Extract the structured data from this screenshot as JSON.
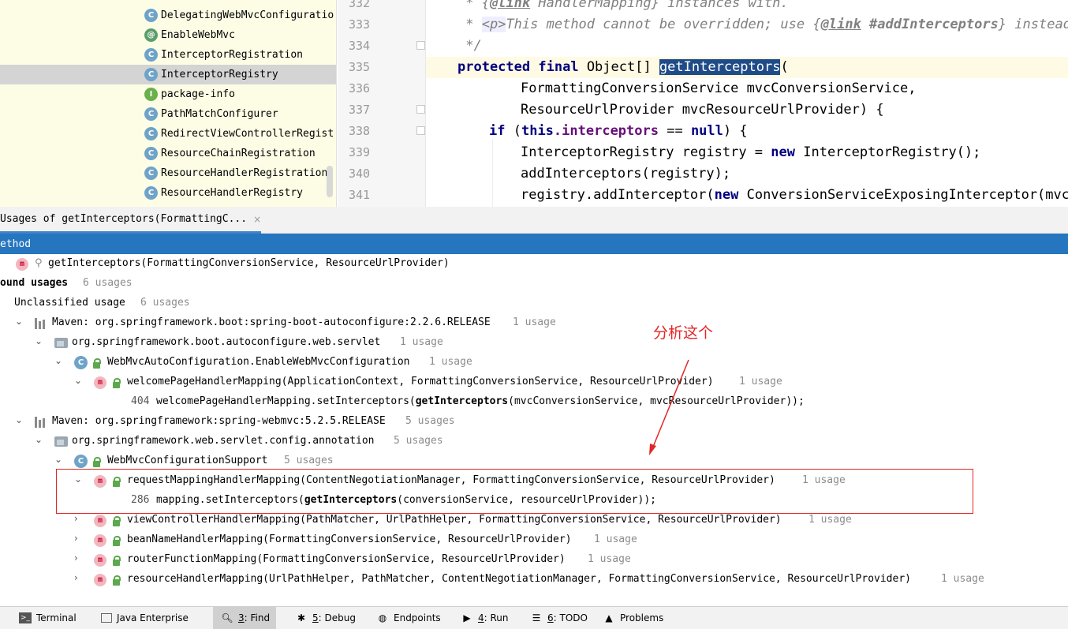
{
  "project_tree": {
    "items": [
      {
        "icon": "class-icon",
        "badge": "C",
        "label": "DelegatingWebMvcConfiguratio",
        "selected": false
      },
      {
        "icon": "annotation-icon",
        "badge": "@",
        "label": "EnableWebMvc",
        "selected": false
      },
      {
        "icon": "class-icon",
        "badge": "C",
        "label": "InterceptorRegistration",
        "selected": false
      },
      {
        "icon": "class-icon",
        "badge": "C",
        "label": "InterceptorRegistry",
        "selected": true
      },
      {
        "icon": "package-info-icon",
        "badge": "I",
        "label": "package-info",
        "selected": false
      },
      {
        "icon": "class-icon",
        "badge": "C",
        "label": "PathMatchConfigurer",
        "selected": false
      },
      {
        "icon": "class-icon",
        "badge": "C",
        "label": "RedirectViewControllerRegist",
        "selected": false
      },
      {
        "icon": "class-icon",
        "badge": "C",
        "label": "ResourceChainRegistration",
        "selected": false
      },
      {
        "icon": "class-icon",
        "badge": "C",
        "label": "ResourceHandlerRegistration",
        "selected": false
      },
      {
        "icon": "class-icon",
        "badge": "C",
        "label": "ResourceHandlerRegistry",
        "selected": false
      }
    ]
  },
  "editor": {
    "line_numbers": [
      "332",
      "333",
      "334",
      "335",
      "336",
      "337",
      "338",
      "339",
      "340",
      "341"
    ],
    "current_line": "335",
    "code": {
      "l332_prefix": " * {",
      "l332_link": "@link",
      "l332_rest": " HandlerMapping} instances with.",
      "l333_prefix": " * ",
      "l333_p": "<p>",
      "l333_mid": "This method cannot be overridden; use {",
      "l333_link": "@link",
      "l333_ref": " #addInterceptors",
      "l333_end": "} instead.",
      "l334": " */",
      "l335_kw1": "protected",
      "l335_kw2": "final",
      "l335_type": "Object[] ",
      "l335_method": "getInterceptors",
      "l335_paren": "(",
      "l336": "FormattingConversionService mvcConversionService,",
      "l337": "ResourceUrlProvider mvcResourceUrlProvider) {",
      "l338_kw": "if",
      "l338_a": " (",
      "l338_this": "this",
      "l338_field": ".interceptors",
      "l338_eq": " == ",
      "l338_null": "null",
      "l338_end": ") {",
      "l339_a": "InterceptorRegistry registry = ",
      "l339_new": "new",
      "l339_b": " InterceptorRegistry();",
      "l340": "addInterceptors(registry);",
      "l341_a": "registry.addInterceptor(",
      "l341_new": "new",
      "l341_b": " ConversionServiceExposingInterceptor(mvcCo"
    }
  },
  "find": {
    "tab_label": "Usages of getInterceptors(FormattingC...",
    "close_glyph": "×",
    "method_header": "ethod",
    "method_signature": "getInterceptors(FormattingConversionService, ResourceUrlProvider)",
    "found_label": "ound usages",
    "found_count": "6 usages",
    "unclassified_label": "Unclassified usage",
    "unclassified_count": "6 usages",
    "groups": {
      "boot_lib": "Maven: org.springframework.boot:spring-boot-autoconfigure:2.2.6.RELEASE",
      "boot_lib_count": "1 usage",
      "boot_pkg": "org.springframework.boot.autoconfigure.web.servlet",
      "boot_pkg_count": "1 usage",
      "boot_class": "WebMvcAutoConfiguration.EnableWebMvcConfiguration",
      "boot_class_count": "1 usage",
      "boot_method": "welcomePageHandlerMapping(ApplicationContext, FormattingConversionService, ResourceUrlProvider)",
      "boot_method_count": "1 usage",
      "boot_line_no": "404",
      "boot_line_a": "welcomePageHandlerMapping.setInterceptors(",
      "boot_line_b": "getInterceptors",
      "boot_line_c": "(mvcConversionService, mvcResourceUrlProvider));",
      "webmvc_lib": "Maven: org.springframework:spring-webmvc:5.2.5.RELEASE",
      "webmvc_lib_count": "5 usages",
      "webmvc_pkg": "org.springframework.web.servlet.config.annotation",
      "webmvc_pkg_count": "5 usages",
      "webmvc_class": "WebMvcConfigurationSupport",
      "webmvc_class_count": "5 usages",
      "m1": "requestMappingHandlerMapping(ContentNegotiationManager, FormattingConversionService, ResourceUrlProvider)",
      "m1_count": "1 usage",
      "m1_line_no": "286",
      "m1_line_a": "mapping.setInterceptors(",
      "m1_line_b": "getInterceptors",
      "m1_line_c": "(conversionService, resourceUrlProvider));",
      "m2": "viewControllerHandlerMapping(PathMatcher, UrlPathHelper, FormattingConversionService, ResourceUrlProvider)",
      "m2_count": "1 usage",
      "m3": "beanNameHandlerMapping(FormattingConversionService, ResourceUrlProvider)",
      "m3_count": "1 usage",
      "m4": "routerFunctionMapping(FormattingConversionService, ResourceUrlProvider)",
      "m4_count": "1 usage",
      "m5": "resourceHandlerMapping(UrlPathHelper, PathMatcher, ContentNegotiationManager, FormattingConversionService, ResourceUrlProvider)",
      "m5_count": "1 usage"
    },
    "annotation_text": "分析这个"
  },
  "bottom_bar": {
    "terminal": "Terminal",
    "java_enterprise": "Java Enterprise",
    "find_num": "3",
    "find_label": ": Find",
    "debug_num": "5",
    "debug_label": ": Debug",
    "endpoints": "Endpoints",
    "run_num": "4",
    "run_label": ": Run",
    "todo_num": "6",
    "todo_label": ": TODO",
    "problems": "Problems"
  },
  "colors": {
    "selection_blue": "#2675bf",
    "annotation_red": "#e32626",
    "keyword_navy": "#000080"
  }
}
